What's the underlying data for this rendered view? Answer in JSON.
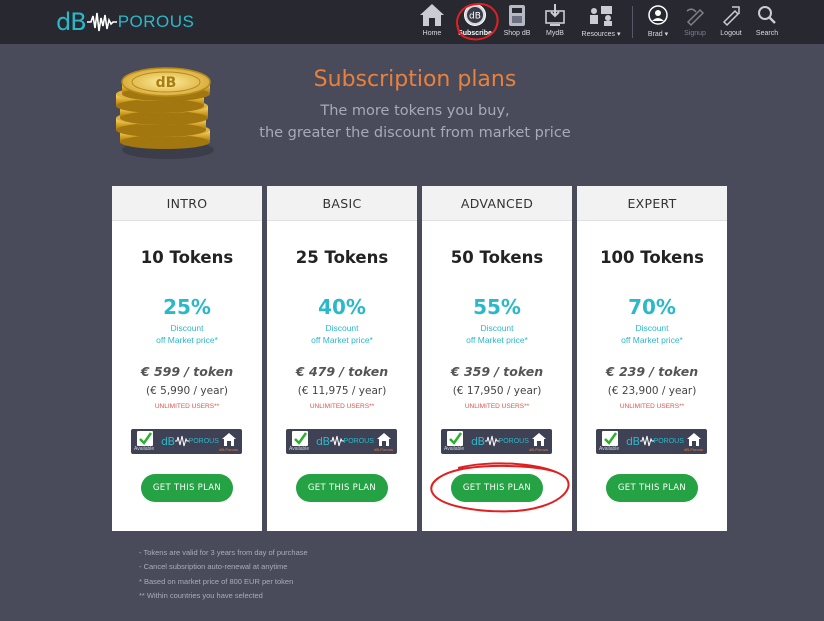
{
  "brand": {
    "name_db": "dB",
    "name_rest": "POROUS"
  },
  "nav": {
    "items": [
      {
        "id": "home",
        "label": "Home",
        "icon": "home-icon"
      },
      {
        "id": "subscribe",
        "label": "Subscribe",
        "icon": "subscribe-icon"
      },
      {
        "id": "shop",
        "label": "Shop dB",
        "icon": "shop-icon"
      },
      {
        "id": "mydb",
        "label": "MydB",
        "icon": "mydb-icon"
      },
      {
        "id": "resources",
        "label": "Resources",
        "icon": "resources-icon"
      },
      {
        "id": "user",
        "label": "Brad",
        "icon": "user-icon"
      },
      {
        "id": "signup",
        "label": "Signup",
        "icon": "signup-icon"
      },
      {
        "id": "logout",
        "label": "Logout",
        "icon": "logout-icon"
      },
      {
        "id": "search",
        "label": "Search",
        "icon": "search-icon"
      }
    ]
  },
  "header": {
    "title": "Subscription plans",
    "subtitle_line1": "The more tokens you buy,",
    "subtitle_line2": "the greater the discount from market price"
  },
  "plans": [
    {
      "name": "INTRO",
      "tokens": "10 Tokens",
      "discount": "25%",
      "discount_label": "Discount",
      "discount_sub": "off Market price*",
      "price": "€ 599 / token",
      "yearly": "(€ 5,990 / year)",
      "users": "UNLIMITED USERS**",
      "button": "GET THIS PLAN"
    },
    {
      "name": "BASIC",
      "tokens": "25 Tokens",
      "discount": "40%",
      "discount_label": "Discount",
      "discount_sub": "off Market price*",
      "price": "€ 479 / token",
      "yearly": "(€ 11,975 / year)",
      "users": "UNLIMITED USERS**",
      "button": "GET THIS PLAN"
    },
    {
      "name": "ADVANCED",
      "tokens": "50 Tokens",
      "discount": "55%",
      "discount_label": "Discount",
      "discount_sub": "off Market price*",
      "price": "€ 359 / token",
      "yearly": "(€ 17,950 / year)",
      "users": "UNLIMITED USERS**",
      "button": "GET THIS PLAN"
    },
    {
      "name": "EXPERT",
      "tokens": "100 Tokens",
      "discount": "70%",
      "discount_label": "Discount",
      "discount_sub": "off Market price*",
      "price": "€ 239 / token",
      "yearly": "(€ 23,900 / year)",
      "users": "UNLIMITED USERS**",
      "button": "GET THIS PLAN"
    }
  ],
  "badge": {
    "available": "Available",
    "logo_db": "dB",
    "logo_rest": "POROUS",
    "sub": "dB-Porous"
  },
  "notes": [
    "- Tokens are valid for 3 years from day of purchase",
    "- Cancel subsription auto-renewal at anytime",
    "* Based on market price of 800 EUR per token",
    "** Within countries you have selected"
  ],
  "colors": {
    "accent": "#2bb8c9",
    "title": "#e8813e",
    "button": "#24a244",
    "annotation": "#e02020",
    "page_bg": "#4a4b5a",
    "nav_bg": "#272830"
  }
}
